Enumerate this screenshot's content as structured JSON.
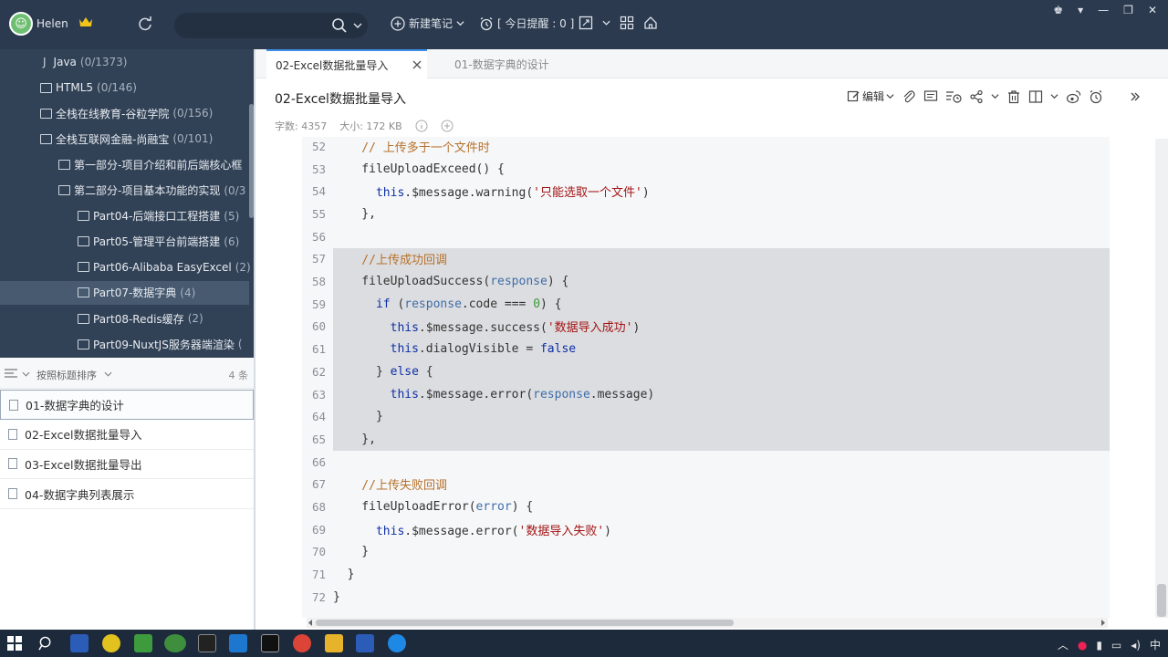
{
  "topbar": {
    "username": "Helen",
    "new_note_label": "新建笔记",
    "reminder_label": "[ 今日提醒 : 0 ]"
  },
  "tree": [
    {
      "label": "Java",
      "count": "(0/1373)"
    },
    {
      "label": "HTML5",
      "count": "(0/146)"
    },
    {
      "label": "全栈在线教育-谷粒学院",
      "count": "(0/156)"
    },
    {
      "label": "全栈互联网金融-尚融宝",
      "count": "(0/101)"
    },
    {
      "label": "第一部分-项目介绍和前后端核心框",
      "count": ""
    },
    {
      "label": "第二部分-项目基本功能的实现",
      "count": "(0/3"
    },
    {
      "label": "Part04-后端接口工程搭建",
      "count": "(5)"
    },
    {
      "label": "Part05-管理平台前端搭建",
      "count": "(6)"
    },
    {
      "label": "Part06-Alibaba EasyExcel",
      "count": "(2)"
    },
    {
      "label": "Part07-数据字典",
      "count": "(4)"
    },
    {
      "label": "Part08-Redis缓存",
      "count": "(2)"
    },
    {
      "label": "Part09-NuxtJS服务器端渲染",
      "count": "("
    }
  ],
  "sortbar": {
    "label": "按照标题排序",
    "count": "4 条"
  },
  "notes": [
    "01-数据字典的设计",
    "02-Excel数据批量导入",
    "03-Excel数据批量导出",
    "04-数据字典列表展示"
  ],
  "tabs": {
    "active": "02-Excel数据批量导入",
    "inactive": "01-数据字典的设计"
  },
  "doc": {
    "title": "02-Excel数据批量导入",
    "word_count": "字数: 4357",
    "size": "大小: 172 KB",
    "edit_label": "编辑"
  },
  "code_lines": [
    {
      "n": "52",
      "hl": false,
      "parts": [
        [
          "cm",
          "    // 上传多于一个文件时"
        ]
      ]
    },
    {
      "n": "53",
      "hl": false,
      "parts": [
        [
          "",
          "    fileUploadExceed() {"
        ]
      ]
    },
    {
      "n": "54",
      "hl": false,
      "parts": [
        [
          "kw",
          "      this"
        ],
        [
          "",
          ".$message.warning("
        ],
        [
          "str",
          "'只能选取一个文件'"
        ],
        [
          "",
          ")"
        ]
      ]
    },
    {
      "n": "55",
      "hl": false,
      "parts": [
        [
          "",
          "    },"
        ]
      ]
    },
    {
      "n": "56",
      "hl": false,
      "parts": [
        [
          "",
          ""
        ]
      ]
    },
    {
      "n": "57",
      "hl": true,
      "parts": [
        [
          "cm",
          "    //上传成功回调"
        ]
      ]
    },
    {
      "n": "58",
      "hl": true,
      "parts": [
        [
          "",
          "    fileUploadSuccess("
        ],
        [
          "prop",
          "response"
        ],
        [
          "",
          ") {"
        ]
      ]
    },
    {
      "n": "59",
      "hl": true,
      "parts": [
        [
          "kw",
          "      if"
        ],
        [
          "",
          " ("
        ],
        [
          "prop",
          "response"
        ],
        [
          "",
          ".code === "
        ],
        [
          "num",
          "0"
        ],
        [
          "",
          ") {"
        ]
      ]
    },
    {
      "n": "60",
      "hl": true,
      "parts": [
        [
          "kw",
          "        this"
        ],
        [
          "",
          ".$message.success("
        ],
        [
          "str",
          "'数据导入成功'"
        ],
        [
          "",
          ")"
        ]
      ]
    },
    {
      "n": "61",
      "hl": true,
      "parts": [
        [
          "kw",
          "        this"
        ],
        [
          "",
          ".dialogVisible = "
        ],
        [
          "kw",
          "false"
        ]
      ]
    },
    {
      "n": "62",
      "hl": true,
      "parts": [
        [
          "",
          "      } "
        ],
        [
          "kw",
          "else"
        ],
        [
          "",
          " {"
        ]
      ]
    },
    {
      "n": "63",
      "hl": true,
      "parts": [
        [
          "kw",
          "        this"
        ],
        [
          "",
          ".$message.error("
        ],
        [
          "prop",
          "response"
        ],
        [
          "",
          ".message)"
        ]
      ]
    },
    {
      "n": "64",
      "hl": true,
      "parts": [
        [
          "",
          "      }"
        ]
      ]
    },
    {
      "n": "65",
      "hl": true,
      "parts": [
        [
          "",
          "    },"
        ]
      ]
    },
    {
      "n": "66",
      "hl": false,
      "parts": [
        [
          "",
          ""
        ]
      ]
    },
    {
      "n": "67",
      "hl": false,
      "parts": [
        [
          "cm",
          "    //上传失败回调"
        ]
      ]
    },
    {
      "n": "68",
      "hl": false,
      "parts": [
        [
          "",
          "    fileUploadError("
        ],
        [
          "prop",
          "error"
        ],
        [
          "",
          ") {"
        ]
      ]
    },
    {
      "n": "69",
      "hl": false,
      "parts": [
        [
          "kw",
          "      this"
        ],
        [
          "",
          ".$message.error("
        ],
        [
          "str",
          "'数据导入失败'"
        ],
        [
          "",
          ")"
        ]
      ]
    },
    {
      "n": "70",
      "hl": false,
      "parts": [
        [
          "",
          "    }"
        ]
      ]
    },
    {
      "n": "71",
      "hl": false,
      "parts": [
        [
          "",
          "  }"
        ]
      ]
    },
    {
      "n": "72",
      "hl": false,
      "parts": [
        [
          "",
          "}"
        ]
      ]
    }
  ],
  "tray": {
    "ime": "中"
  }
}
